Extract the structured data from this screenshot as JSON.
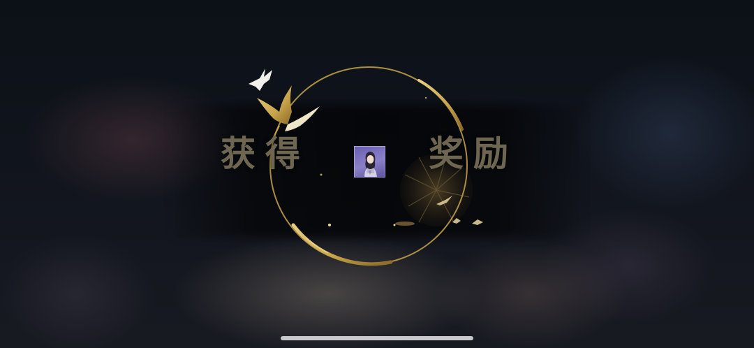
{
  "reward_popup": {
    "title_left": "获得",
    "title_right": "奖励",
    "item": {
      "icon": "character-portrait-icon",
      "frame_color": "#7a70c0"
    },
    "decorations": [
      "crane-icon",
      "crane-icon",
      "chrysanthemum-icon",
      "bird-icon",
      "bird-icon",
      "bird-icon"
    ]
  },
  "colors": {
    "gold": "#c9a44a",
    "title_text": "#6e6650"
  }
}
